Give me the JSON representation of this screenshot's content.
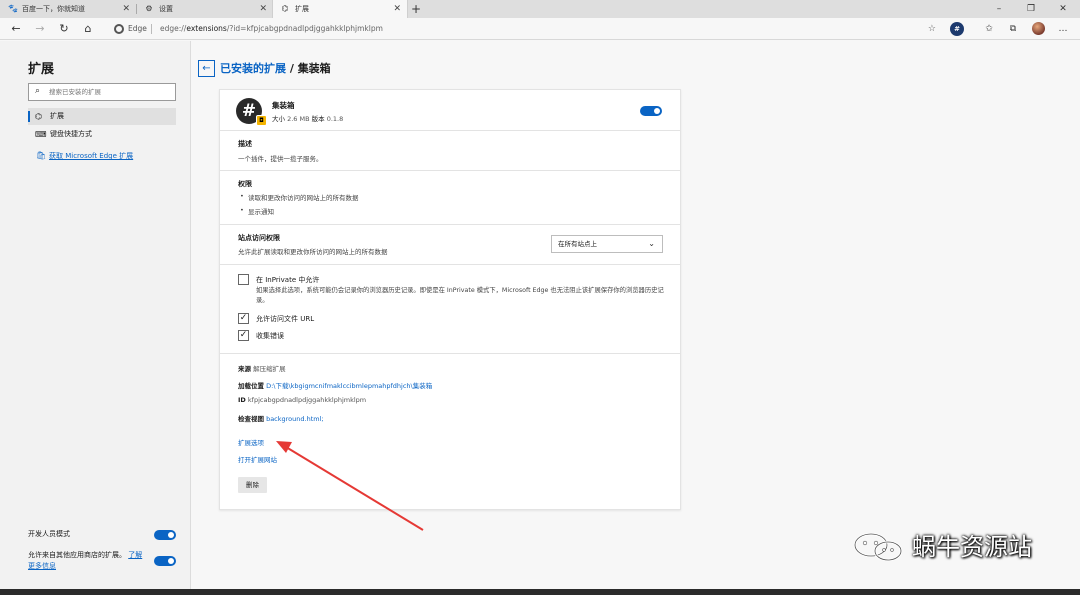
{
  "browser": {
    "tabs": [
      {
        "label": "百度一下，你就知道",
        "close": "✕",
        "active": false
      },
      {
        "label": "设置",
        "close": "✕",
        "active": false
      },
      {
        "label": "扩展",
        "close": "✕",
        "active": true
      }
    ],
    "new_tab": "+",
    "window_controls": {
      "minimize": "–",
      "maximize": "❐",
      "close": "✕"
    },
    "address": {
      "scheme_label": "Edge",
      "url_prefix": "edge://",
      "url_host": "extensions",
      "url_rest": "/?id=kfpjcabgpdnadlpdjggahkklphjmklpm"
    },
    "nav": {
      "back": "←",
      "forward": "→",
      "reload": "↻",
      "home": "⌂"
    },
    "toolbar_icons": [
      "favorite-star-icon",
      "extension-icon",
      "favorites-icon",
      "collections-icon",
      "profile-avatar",
      "more-icon"
    ],
    "toolbar_glyphs": {
      "star": "☆",
      "ext": "#",
      "favs": "✩",
      "coll": "⧉",
      "more": "…"
    }
  },
  "sidebar": {
    "title": "扩展",
    "search_placeholder": "搜索已安装的扩展",
    "items": [
      {
        "label": "扩展",
        "icon": "puzzle-icon",
        "glyph": "⌬",
        "active": true
      },
      {
        "label": "键盘快捷方式",
        "icon": "keyboard-icon",
        "glyph": "⌨",
        "active": false
      }
    ],
    "store_link": "获取 Microsoft Edge 扩展",
    "store_glyph": "🛍",
    "dev_mode_label": "开发人员模式",
    "dev_mode_on": true,
    "allow_other_stores": "允许来自其他应用商店的扩展。",
    "allow_other_stores_link": "了解更多信息",
    "allow_other_stores_on": true
  },
  "header": {
    "back": "←",
    "crumb_link": "已安装的扩展",
    "crumb_sep": " / ",
    "crumb_current": "集装箱"
  },
  "extension": {
    "logo_glyph": "#",
    "badge_glyph": "◘",
    "name": "集装箱",
    "size_label": "大小",
    "size_value": "2.6 MB",
    "version_label": "版本",
    "version_value": "0.1.8",
    "enabled": true,
    "description_heading": "描述",
    "description": "一个插件，提供一揽子服务。",
    "permissions_heading": "权限",
    "permissions": [
      "读取和更改你访问的网站上的所有数据",
      "显示通知"
    ],
    "site_access_heading": "站点访问权限",
    "site_access_desc": "允许此扩展读取和更改你所访问的网站上的所有数据",
    "site_access_value": "在所有站点上",
    "inprivate_label": "在 InPrivate 中允许",
    "inprivate_checked": false,
    "inprivate_desc": "如果选择此选项，系统可能仍会记录你的浏览器历史记录。即使是在 InPrivate 模式下，Microsoft Edge 也无法阻止该扩展保存你的浏览器历史记录。",
    "file_url_label": "允许访问文件 URL",
    "file_url_checked": true,
    "errors_label": "收集错误",
    "errors_checked": true,
    "check_glyph": "✓",
    "source_label": "来源",
    "source_value": "解压缩扩展",
    "load_label": "加载位置",
    "load_value": "D:\\下载\\kbgigmcnifmaklccibmlepmahpfdhjch\\集装箱",
    "id_label": "ID",
    "id_value": "kfpjcabgpdnadlpdjggahkklphjmklpm",
    "inspect_label": "检查视图",
    "inspect_value": "background.html;",
    "options_link": "扩展选项",
    "website_link": "打开扩展网站",
    "remove_button": "删除"
  },
  "watermark": {
    "text": "蜗牛资源站"
  },
  "colors": {
    "accent": "#0a64c4",
    "annotation_arrow": "#e53935"
  }
}
